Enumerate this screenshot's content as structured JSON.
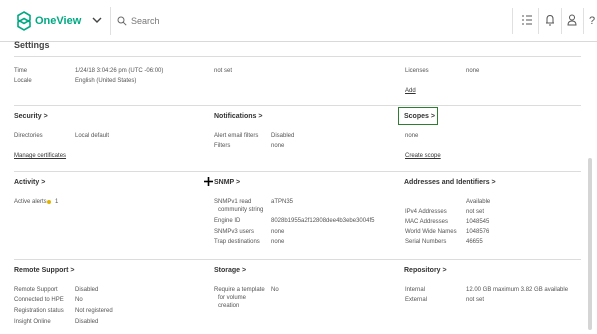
{
  "header": {
    "brand": "OneView",
    "search_placeholder": "Search",
    "icons": [
      "logo-icon",
      "chevron-down-icon",
      "search-icon",
      "activity-list-icon",
      "notifications-bell-icon",
      "user-icon",
      "help-icon"
    ],
    "accent_color": "#01a982"
  },
  "page": {
    "title": "Settings"
  },
  "general": {
    "time_label": "Time",
    "time_value": "1/24/18 3:04:26 pm (UTC -06:00)",
    "locale_label": "Locale",
    "locale_value": "English (United States)",
    "ntp_value": "not set",
    "licenses_label": "Licenses",
    "licenses_value": "none",
    "add_link": "Add"
  },
  "security": {
    "heading": "Security >",
    "directories_label": "Directories",
    "directories_value": "Local default",
    "certificate_link": "Manage certificates"
  },
  "notifications": {
    "heading": "Notifications >",
    "alert_email_label": "Alert email filters",
    "alert_email_value": "Disabled",
    "filters_label": "Filters",
    "filters_value": "none"
  },
  "scopes": {
    "heading": "Scopes >",
    "value": "none",
    "create_link": "Create scope"
  },
  "activity": {
    "heading": "Activity >",
    "active_alerts_label": "Active alerts",
    "active_alerts_value": "1"
  },
  "snmp": {
    "heading": "SNMP >",
    "read_label_1": "SNMPv1 read",
    "read_label_2": "community string",
    "read_value": "aTPN35",
    "engine_label": "Engine ID",
    "engine_value": "8028b1955a2f12808dee4b3ebe3004f5",
    "users_label": "SNMPv3 users",
    "users_value": "none",
    "trap_label": "Trap destinations",
    "trap_value": "none"
  },
  "addresses": {
    "heading": "Addresses and Identifiers >",
    "available_label": "Available",
    "ipv4_label": "IPv4 Addresses",
    "ipv4_value": "not set",
    "mac_label": "MAC Addresses",
    "mac_value": "1048545",
    "wwn_label": "World Wide Names",
    "wwn_value": "1048576",
    "serial_label": "Serial Numbers",
    "serial_value": "46655"
  },
  "remote_support": {
    "heading": "Remote Support >",
    "rs_label": "Remote Support",
    "rs_value": "Disabled",
    "hpe_label": "Connected to HPE",
    "hpe_value": "No",
    "reg_label": "Registration status",
    "reg_value": "Not registered",
    "insight_label": "Insight Online",
    "insight_value": "Disabled"
  },
  "storage": {
    "heading": "Storage >",
    "req_label_1": "Require a template",
    "req_label_2": "for volume",
    "req_label_3": "creation",
    "req_value": "No"
  },
  "repository": {
    "heading": "Repository >",
    "internal_label": "Internal",
    "internal_value": "12.00 GB maximum 3.82 GB available",
    "external_label": "External",
    "external_value": "not set"
  }
}
